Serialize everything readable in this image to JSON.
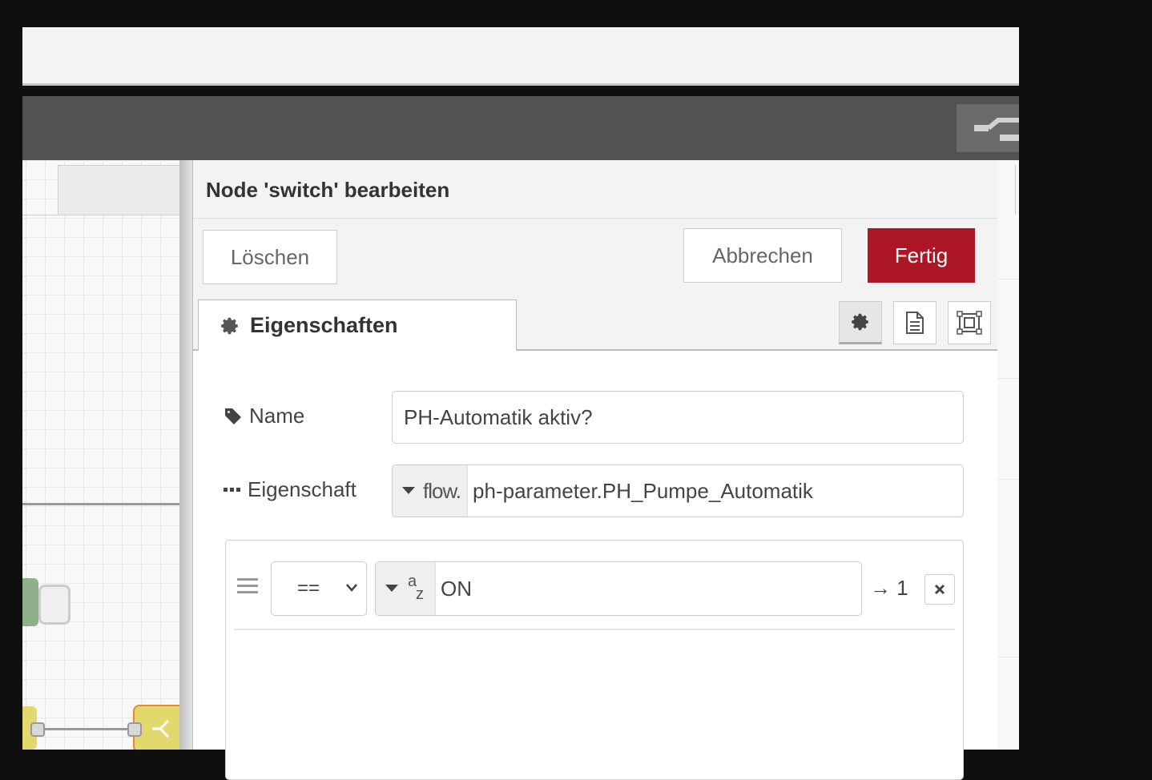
{
  "editor": {
    "title": "Node 'switch' bearbeiten",
    "delete_label": "Löschen",
    "cancel_label": "Abbrechen",
    "done_label": "Fertig",
    "accent_color": "#ad1625"
  },
  "tabs": [
    {
      "label": "Eigenschaften",
      "icon": "gear-icon",
      "active": true
    }
  ],
  "tab_icons": [
    "gear-icon",
    "description-icon",
    "appearance-icon"
  ],
  "form": {
    "name": {
      "label": "Name",
      "icon": "tag-icon",
      "value": "PH-Automatik aktiv?"
    },
    "property": {
      "label": "Eigenschaft",
      "icon": "ellipsis-icon",
      "type_prefix": "flow.",
      "value": "ph-parameter.PH_Pumpe_Automatik"
    }
  },
  "rules": [
    {
      "operator": "==",
      "value_type": "string",
      "value": "ON",
      "output": "→ 1"
    }
  ]
}
